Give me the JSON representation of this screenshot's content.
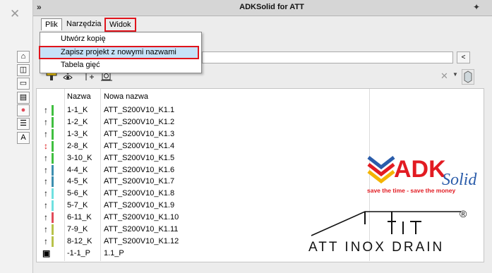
{
  "window": {
    "title": "ADKSolid for ATT",
    "collapse_glyph": "»",
    "pin_glyph": "✦",
    "close_glyph": "✕"
  },
  "menu": {
    "items": [
      "Plik",
      "Narzędzia",
      "Widok"
    ]
  },
  "dropdown": {
    "items": [
      "Utwórz kopię",
      "Zapisz projekt z nowymi nazwami",
      "Tabela gięć"
    ]
  },
  "path_button": "<",
  "toolbar": {
    "icons": [
      "stamp-icon",
      "eye-down-icon",
      "add-up-icon",
      "frame-icon"
    ],
    "remove_glyph": "✕",
    "dropdown_glyph": "▼"
  },
  "table": {
    "headers": [
      "Nazwa",
      "Nowa nazwa"
    ],
    "rows": [
      {
        "name": "1-1_K",
        "new_name": "ATT_S200V10_K1.1",
        "arrow": "↑",
        "color": "#3fbf3f"
      },
      {
        "name": "1-2_K",
        "new_name": "ATT_S200V10_K1.2",
        "arrow": "↑",
        "color": "#3fbf3f"
      },
      {
        "name": "1-3_K",
        "new_name": "ATT_S200V10_K1.3",
        "arrow": "↑",
        "color": "#3fbf3f"
      },
      {
        "name": "2-8_K",
        "new_name": "ATT_S200V10_K1.4",
        "arrow": "↕",
        "color": "#3fbf3f"
      },
      {
        "name": "3-10_K",
        "new_name": "ATT_S200V10_K1.5",
        "arrow": "↑",
        "color": "#3fbf3f"
      },
      {
        "name": "4-4_K",
        "new_name": "ATT_S200V10_K1.6",
        "arrow": "↑",
        "color": "#3d8fb0"
      },
      {
        "name": "4-5_K",
        "new_name": "ATT_S200V10_K1.7",
        "arrow": "↑",
        "color": "#3d8fb0"
      },
      {
        "name": "5-6_K",
        "new_name": "ATT_S200V10_K1.8",
        "arrow": "↑",
        "color": "#6fe0e0"
      },
      {
        "name": "5-7_K",
        "new_name": "ATT_S200V10_K1.9",
        "arrow": "↑",
        "color": "#6fe0e0"
      },
      {
        "name": "6-11_K",
        "new_name": "ATT_S200V10_K1.10",
        "arrow": "↑",
        "color": "#e04b5a"
      },
      {
        "name": "7-9_K",
        "new_name": "ATT_S200V10_K1.11",
        "arrow": "↑",
        "color": "#b8c24a"
      },
      {
        "name": "8-12_K",
        "new_name": "ATT_S200V10_K1.12",
        "arrow": "↑",
        "color": "#b8c24a"
      },
      {
        "name": "-1-1_P",
        "new_name": "1.1_P",
        "arrow": "▣",
        "color": "#ffffff"
      }
    ]
  },
  "side_icons": [
    "home-icon",
    "cube-icon",
    "folder-icon",
    "sheet-icon",
    "palette-icon",
    "list-icon",
    "text-icon"
  ],
  "adk_logo": {
    "brand": "ADK",
    "script": "Solid",
    "tagline": "save the time - save the money"
  },
  "att_logo": {
    "text": "ATT INOX DRAIN",
    "registered": "®"
  }
}
